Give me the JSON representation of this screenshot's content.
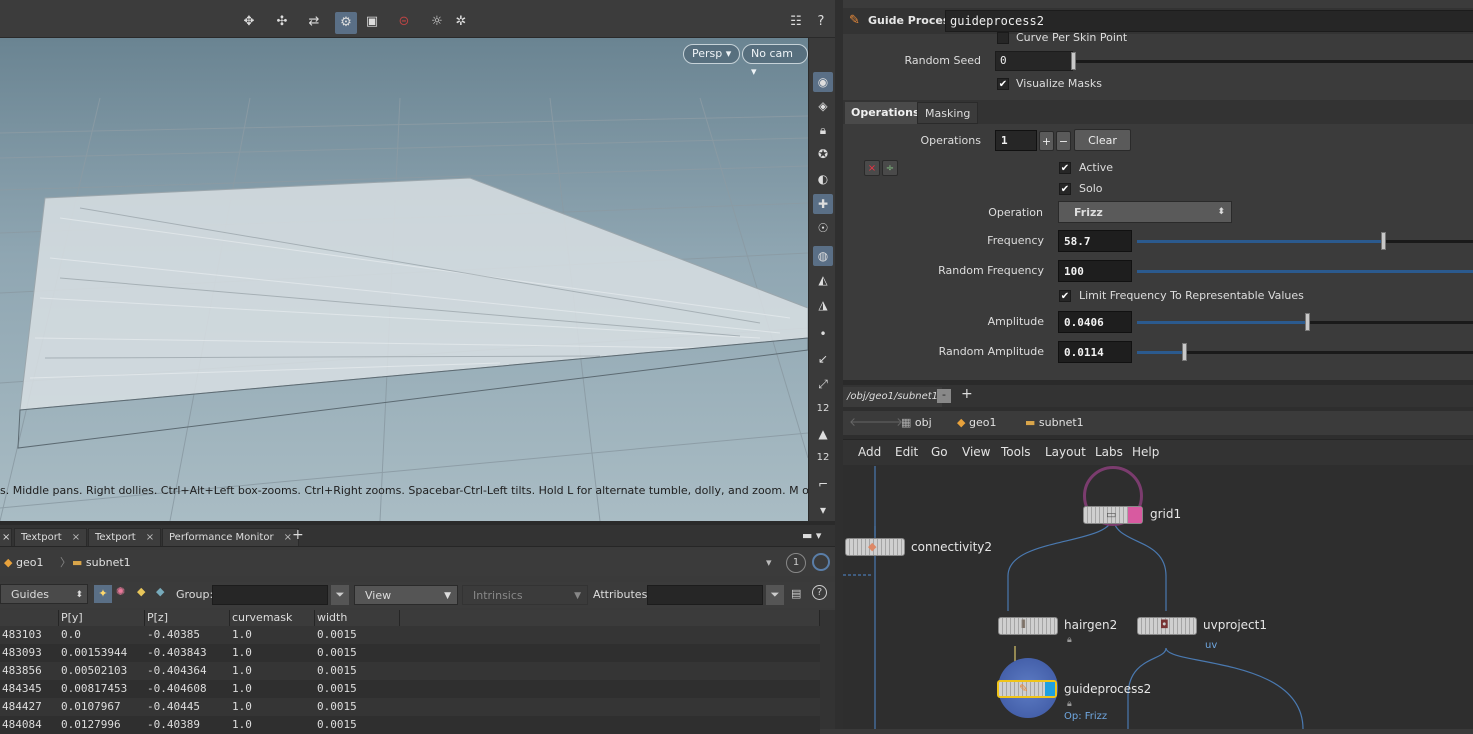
{
  "viewport": {
    "persp_label": "Persp",
    "cam_label": "No cam",
    "message": "s. Middle pans. Right dollies. Ctrl+Alt+Left box-zooms. Ctrl+Right zooms. Spacebar-Ctrl-Left tilts. Hold L for alternate tumble, dolly, and zoom. M or Alt+M for First"
  },
  "bottom_tabs": [
    "Textport",
    "Textport",
    "Performance Monitor"
  ],
  "bottom_path": {
    "node1": "geo1",
    "node2": "subnet1",
    "badge": "1"
  },
  "spreadsheet": {
    "mode": "Guides",
    "group_label": "Group:",
    "view_label": "View",
    "intrinsics_label": "Intrinsics",
    "attributes_label": "Attributes:",
    "columns": [
      "",
      "P[y]",
      "P[z]",
      "curvemask",
      "width"
    ],
    "rows": [
      [
        "483103",
        "0.0",
        "-0.40385",
        "1.0",
        "0.0015"
      ],
      [
        "483093",
        "0.00153944",
        "-0.403843",
        "1.0",
        "0.0015"
      ],
      [
        "483856",
        "0.00502103",
        "-0.404364",
        "1.0",
        "0.0015"
      ],
      [
        "484345",
        "0.00817453",
        "-0.404608",
        "1.0",
        "0.0015"
      ],
      [
        "484427",
        "0.0107967",
        "-0.40445",
        "1.0",
        "0.0015"
      ],
      [
        "484084",
        "0.0127996",
        "-0.40389",
        "1.0",
        "0.0015"
      ]
    ]
  },
  "params": {
    "node_type": "Guide Process",
    "node_name": "guideprocess2",
    "curve_per_skin_point": "Curve Per Skin Point",
    "random_seed_label": "Random Seed",
    "random_seed_value": "0",
    "visualize_masks": "Visualize Masks",
    "tabs": [
      "Operations",
      "Masking"
    ],
    "operations_label": "Operations",
    "operations_value": "1",
    "clear_label": "Clear",
    "active_label": "Active",
    "solo_label": "Solo",
    "operation_label": "Operation",
    "operation_value": "Frizz",
    "frequency_label": "Frequency",
    "frequency_value": "58.7",
    "random_frequency_label": "Random Frequency",
    "random_frequency_value": "100",
    "limit_label": "Limit Frequency To Representable Values",
    "amplitude_label": "Amplitude",
    "amplitude_value": "0.0406",
    "random_amplitude_label": "Random Amplitude",
    "random_amplitude_value": "0.0114"
  },
  "network": {
    "tab_path": "/obj/geo1/subnet1",
    "path": [
      "obj",
      "geo1",
      "subnet1"
    ],
    "menu": [
      "Add",
      "Edit",
      "Go",
      "View",
      "Tools",
      "Layout",
      "Labs",
      "Help"
    ],
    "nodes": {
      "connectivity2": "connectivity2",
      "grid1": "grid1",
      "hairgen2": "hairgen2",
      "uvproject1": "uvproject1",
      "uv_label": "uv",
      "guideprocess2": "guideprocess2",
      "op_label": "Op: Frizz"
    }
  },
  "colors": {
    "accent_blue": "#2b5a8e",
    "selected_node": "#f0c419",
    "grid_ring": "#7b3c6e"
  }
}
